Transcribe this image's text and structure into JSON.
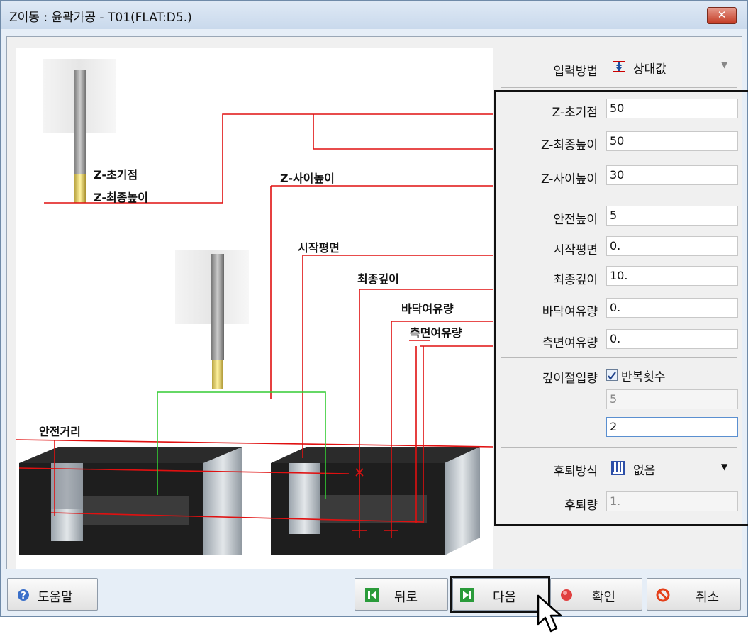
{
  "window": {
    "title": "Z이동 : 윤곽가공 - T01(FLAT:D5.)",
    "close_label": "✕"
  },
  "diagram": {
    "labels": {
      "z_init": "Z-초기점",
      "z_final": "Z-최종높이",
      "z_between": "Z-사이높이",
      "start_plane": "시작평면",
      "final_depth": "최종깊이",
      "floor_stock": "바닥여유량",
      "side_stock": "측면여유량",
      "safe_dist": "안전거리"
    }
  },
  "form": {
    "input_method": {
      "label": "입력방법",
      "value": "상대값"
    },
    "z_init": {
      "label": "Z-초기점",
      "value": "50"
    },
    "z_final": {
      "label": "Z-최종높이",
      "value": "50"
    },
    "z_between": {
      "label": "Z-사이높이",
      "value": "30"
    },
    "safe_height": {
      "label": "안전높이",
      "value": "5"
    },
    "start_plane": {
      "label": "시작평면",
      "value": "0."
    },
    "final_depth": {
      "label": "최종깊이",
      "value": "10."
    },
    "floor_stock": {
      "label": "바닥여유량",
      "value": "0."
    },
    "side_stock": {
      "label": "측면여유량",
      "value": "0."
    },
    "depth_cut": {
      "label": "깊이절입량",
      "checkbox_label": "반복횟수",
      "checked": true,
      "value_disabled": "5",
      "value_active": "2"
    },
    "retract_method": {
      "label": "후퇴방식",
      "value": "없음"
    },
    "retract_amount": {
      "label": "후퇴량",
      "value": "1."
    }
  },
  "buttons": {
    "help": "도움말",
    "back": "뒤로",
    "next": "다음",
    "ok": "확인",
    "cancel": "취소"
  }
}
